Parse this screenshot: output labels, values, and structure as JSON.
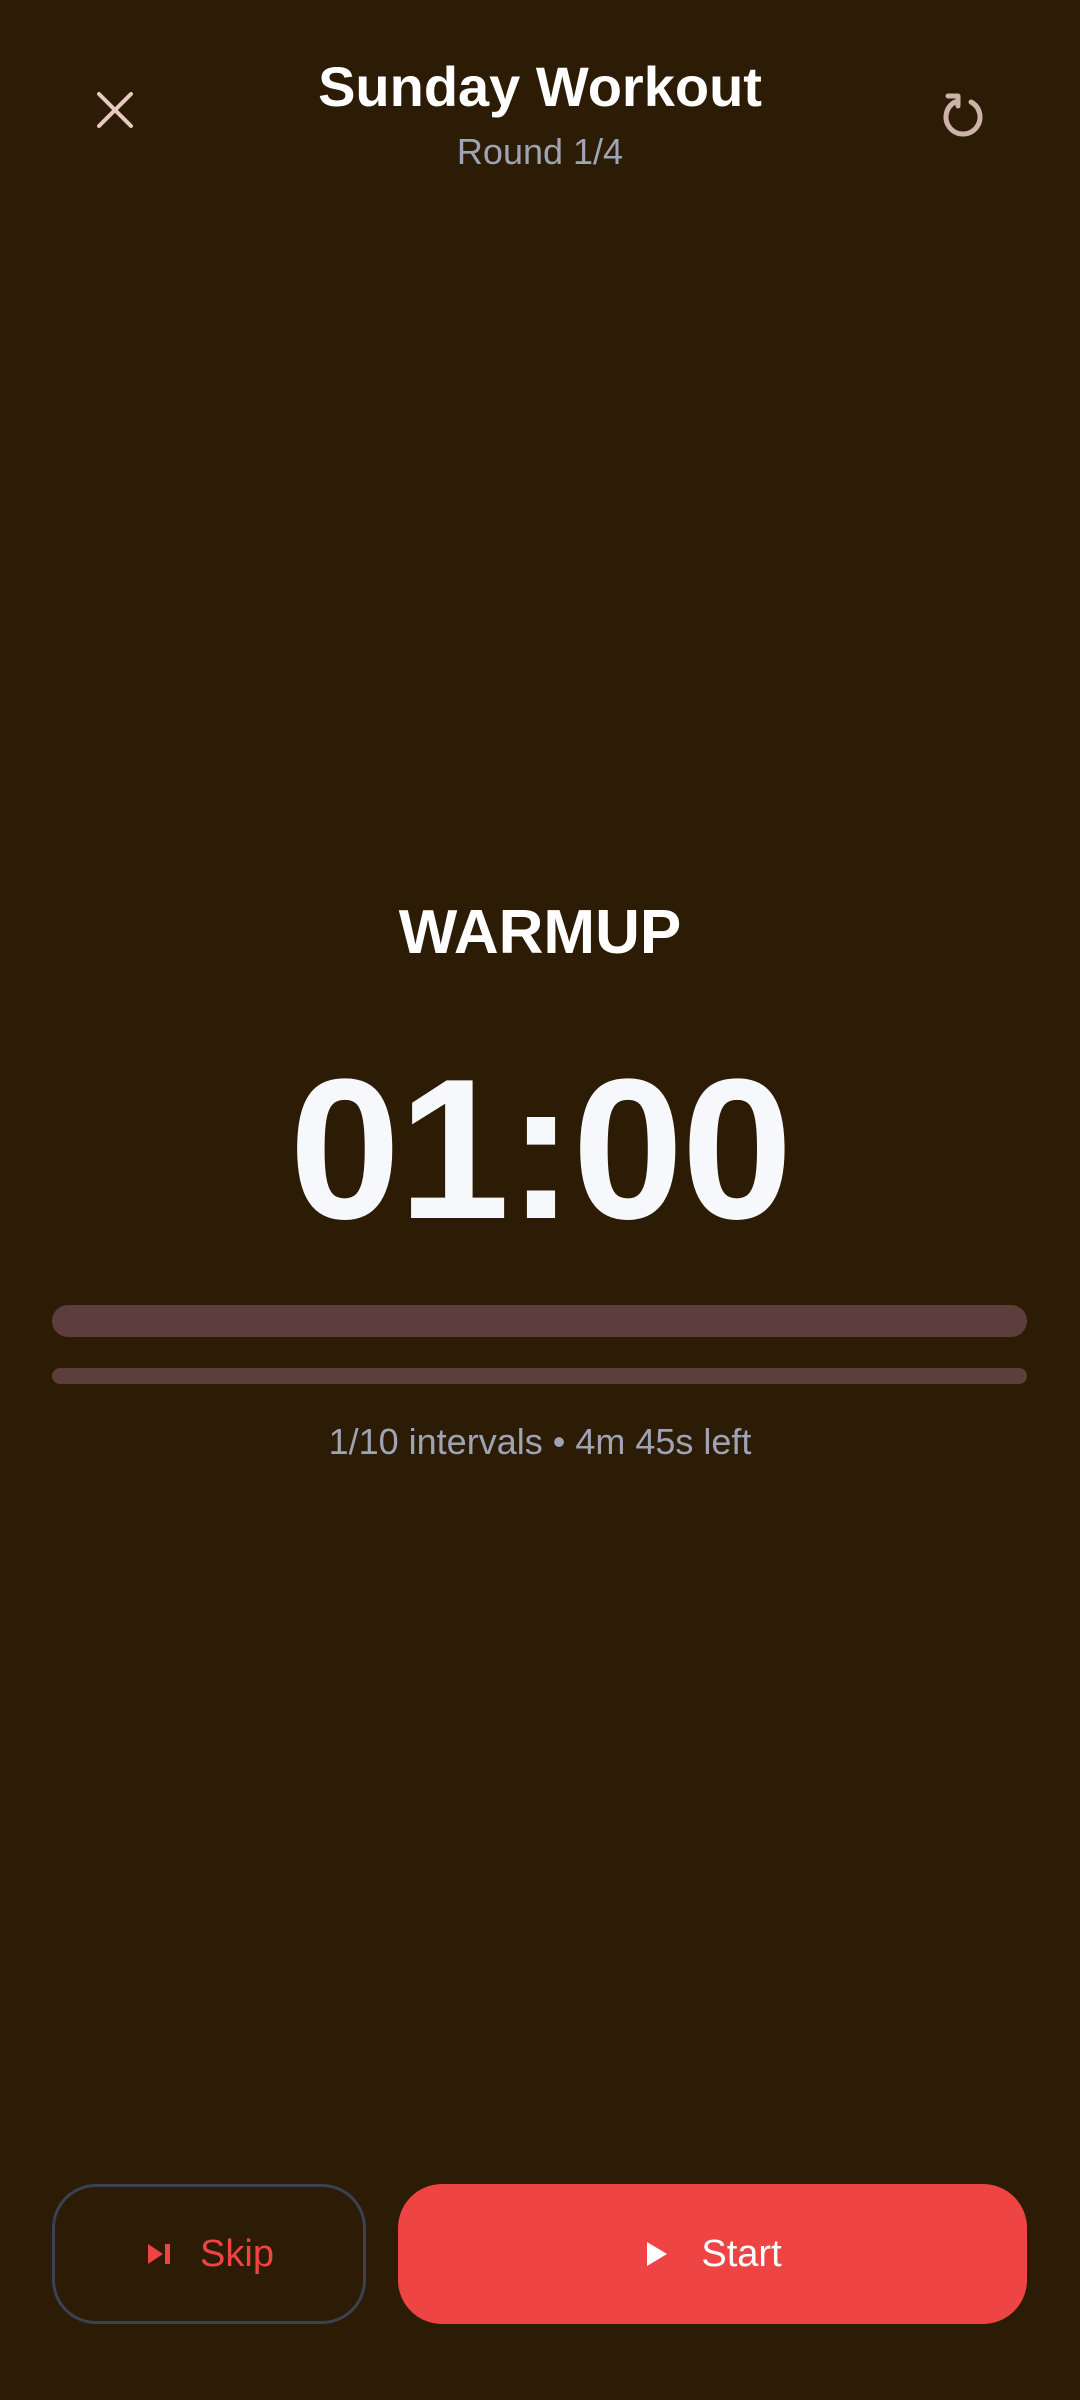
{
  "header": {
    "title": "Sunday Workout",
    "round": "Round 1/4",
    "close_icon": "close-icon",
    "reset_icon": "reset-icon"
  },
  "timer": {
    "phase": "WARMUP",
    "time": "01:00",
    "interval_progress": 0,
    "total_progress": 0,
    "status": "1/10 intervals • 4m 45s left"
  },
  "actions": {
    "skip_label": "Skip",
    "skip_icon": "skip-next-icon",
    "start_label": "Start",
    "start_icon": "play-icon"
  },
  "colors": {
    "background": "#2c1c05",
    "accent": "#ef4444",
    "track": "#5d3e3c",
    "muted_text": "#9fa4b4"
  }
}
